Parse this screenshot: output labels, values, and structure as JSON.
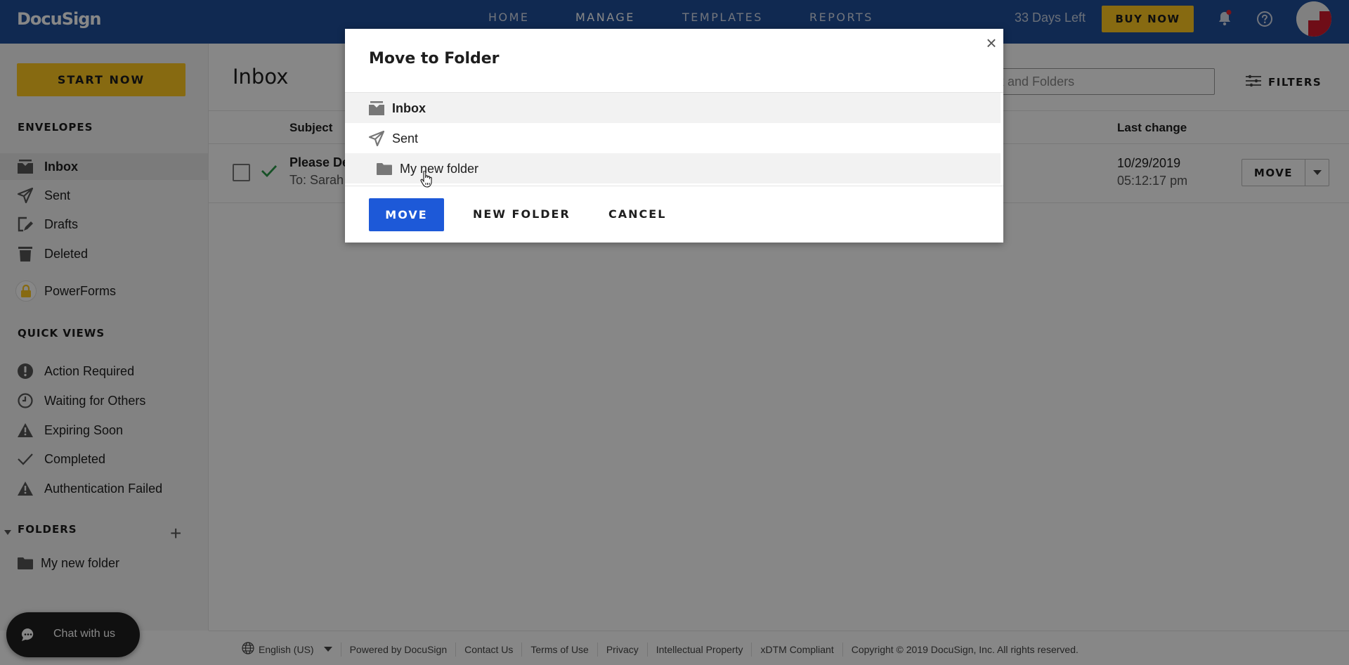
{
  "header": {
    "logo": "DocuSign",
    "nav": [
      {
        "label": "HOME",
        "active": false
      },
      {
        "label": "MANAGE",
        "active": true
      },
      {
        "label": "TEMPLATES",
        "active": false
      },
      {
        "label": "REPORTS",
        "active": false
      }
    ],
    "trial_status": "33 Days Left",
    "buy_now_label": "BUY NOW",
    "brand_color": "#1f4f9a",
    "accent_color": "#ffc820",
    "notification_dot": true
  },
  "sidebar": {
    "start_now_label": "START NOW",
    "envelopes_title": "ENVELOPES",
    "envelopes": [
      {
        "label": "Inbox",
        "icon": "inbox-icon",
        "active": true
      },
      {
        "label": "Sent",
        "icon": "send-icon",
        "active": false
      },
      {
        "label": "Drafts",
        "icon": "draft-icon",
        "active": false
      },
      {
        "label": "Deleted",
        "icon": "trash-icon",
        "active": false
      }
    ],
    "powerforms_label": "PowerForms",
    "quick_views_title": "QUICK VIEWS",
    "quick_views": [
      {
        "label": "Action Required",
        "icon": "exclamation-icon"
      },
      {
        "label": "Waiting for Others",
        "icon": "clock-icon"
      },
      {
        "label": "Expiring Soon",
        "icon": "warning-icon"
      },
      {
        "label": "Completed",
        "icon": "check-icon"
      },
      {
        "label": "Authentication Failed",
        "icon": "warning-icon"
      }
    ],
    "folders_title": "FOLDERS",
    "folders": [
      {
        "label": "My new folder",
        "icon": "folder-icon"
      }
    ]
  },
  "main": {
    "title": "Inbox",
    "search_value": "box and Folders",
    "filters_label": "FILTERS",
    "columns": {
      "subject": "Subject",
      "last_change": "Last change"
    },
    "rows": [
      {
        "subject": "Please De",
        "recipient": "To: Sarah",
        "date": "10/29/2019",
        "time": "05:12:17 pm",
        "status_icon": "completed-check-icon",
        "action_label": "MOVE"
      }
    ]
  },
  "footer": {
    "language": "English (US)",
    "links": [
      "Powered by DocuSign",
      "Contact Us",
      "Terms of Use",
      "Privacy",
      "Intellectual Property",
      "xDTM Compliant"
    ],
    "copyright": "Copyright © 2019 DocuSign, Inc. All rights reserved."
  },
  "chat": {
    "label": "Chat with us"
  },
  "modal": {
    "title": "Move to Folder",
    "close_label": "×",
    "folders": [
      {
        "label": "Inbox",
        "icon": "inbox-icon",
        "selected": true,
        "indent": false
      },
      {
        "label": "Sent",
        "icon": "send-icon",
        "selected": false,
        "indent": false
      },
      {
        "label": "My new folder",
        "icon": "folder-icon",
        "selected": false,
        "indent": true,
        "hover": true
      }
    ],
    "move_label": "MOVE",
    "new_folder_label": "NEW FOLDER",
    "cancel_label": "CANCEL",
    "primary_color": "#1d59d8"
  }
}
